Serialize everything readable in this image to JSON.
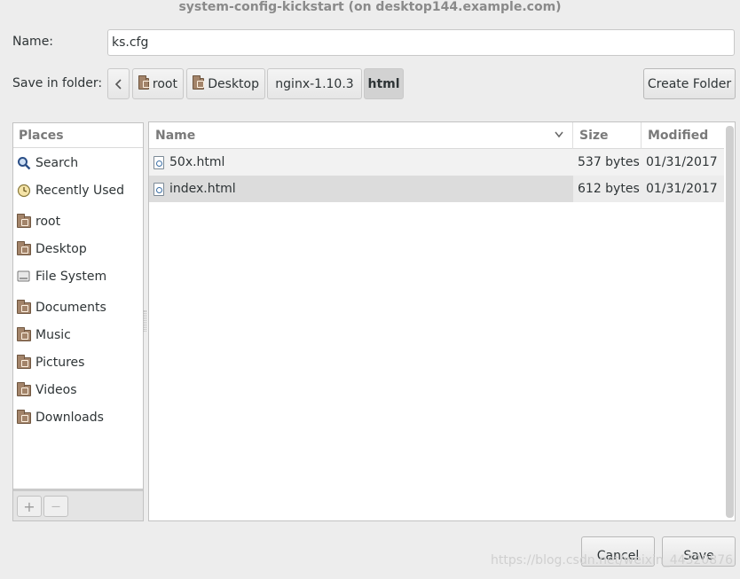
{
  "window": {
    "title": "system-config-kickstart (on desktop144.example.com)"
  },
  "form": {
    "name_label": "Name:",
    "name_value": "ks.cfg",
    "save_in_label": "Save in folder:"
  },
  "breadcrumb": {
    "items": [
      {
        "label": "root",
        "icon": "home-folder-icon"
      },
      {
        "label": "Desktop",
        "icon": "desktop-folder-icon"
      },
      {
        "label": "nginx-1.10.3"
      },
      {
        "label": "html",
        "active": true
      }
    ]
  },
  "toolbar": {
    "create_folder_label": "Create Folder"
  },
  "places": {
    "header": "Places",
    "items": [
      {
        "label": "Search",
        "icon": "search-icon"
      },
      {
        "label": "Recently Used",
        "icon": "recent-clock-icon"
      },
      {
        "label": "root",
        "icon": "home-folder-icon"
      },
      {
        "label": "Desktop",
        "icon": "desktop-folder-icon"
      },
      {
        "label": "File System",
        "icon": "drive-icon"
      },
      {
        "label": "Documents",
        "icon": "documents-folder-icon"
      },
      {
        "label": "Music",
        "icon": "music-folder-icon"
      },
      {
        "label": "Pictures",
        "icon": "pictures-folder-icon"
      },
      {
        "label": "Videos",
        "icon": "videos-folder-icon"
      },
      {
        "label": "Downloads",
        "icon": "downloads-folder-icon"
      }
    ],
    "add_label": "+",
    "remove_label": "—"
  },
  "file_list": {
    "columns": {
      "name": "Name",
      "size": "Size",
      "modified": "Modified"
    },
    "rows": [
      {
        "name": "50x.html",
        "size": "537 bytes",
        "modified": "01/31/2017"
      },
      {
        "name": "index.html",
        "size": "612 bytes",
        "modified": "01/31/2017"
      }
    ]
  },
  "actions": {
    "cancel_label": "Cancel",
    "save_label": "Save"
  },
  "watermark": "https://blog.csdn.net/weixin_44320876"
}
